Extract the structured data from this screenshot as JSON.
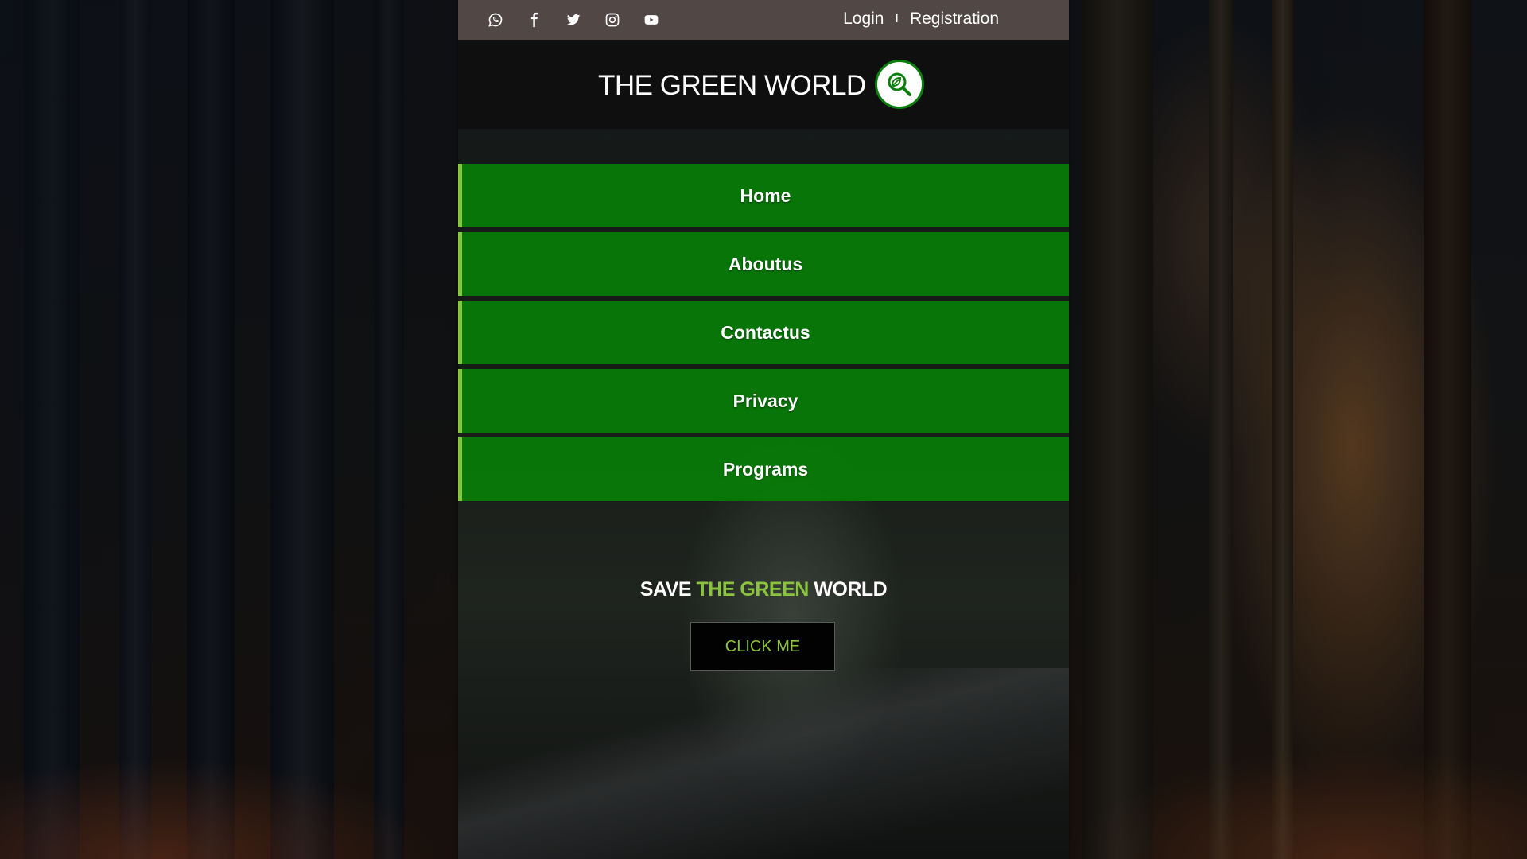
{
  "topbar": {
    "social": [
      {
        "icon": "whatsapp-icon"
      },
      {
        "icon": "facebook-icon"
      },
      {
        "icon": "twitter-icon"
      },
      {
        "icon": "instagram-icon"
      },
      {
        "icon": "youtube-icon"
      }
    ],
    "login_label": "Login",
    "separator": "I",
    "registration_label": "Registration"
  },
  "brand": {
    "title": "THE GREEN WORLD",
    "logo_icon": "leaf-magnifier-icon"
  },
  "nav": {
    "items": [
      {
        "label": "Home"
      },
      {
        "label": "Aboutus"
      },
      {
        "label": "Contactus"
      },
      {
        "label": "Privacy"
      },
      {
        "label": "Programs"
      }
    ]
  },
  "hero": {
    "title_prefix": "SAVE",
    "title_accent": "THE GREEN",
    "title_suffix": "WORLD",
    "cta_label": "CLICK ME"
  },
  "colors": {
    "accent_green": "#8ac43f",
    "nav_green": "#068206",
    "topbar": "#514846",
    "brandbar": "#0f0f0f"
  }
}
